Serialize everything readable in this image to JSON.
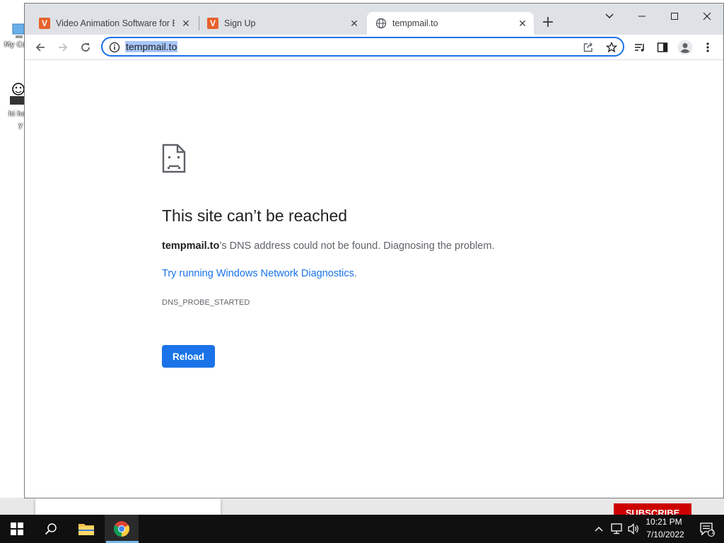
{
  "desktop": {
    "icon1_label": "My Co",
    "icon2_label": "hi he",
    "icon2_sub": "y",
    "subscribe_label": "SUBSCRIBE"
  },
  "browser": {
    "tabs": [
      {
        "title": "Video Animation Software for Bu",
        "favicon": "V",
        "active": false
      },
      {
        "title": "Sign Up",
        "favicon": "V",
        "active": false
      },
      {
        "title": "tempmail.to",
        "favicon": "globe-icon",
        "active": true
      }
    ],
    "address": {
      "url": "tempmail.to"
    }
  },
  "error_page": {
    "title": "This site can’t be reached",
    "host": "tempmail.to",
    "description_rest": "’s DNS address could not be found. Diagnosing the problem.",
    "link_text": "Try running Windows Network Diagnostics",
    "link_period": ".",
    "error_code": "DNS_PROBE_STARTED",
    "reload_label": "Reload"
  },
  "taskbar": {
    "time": "10:21 PM",
    "date": "7/10/2022",
    "notification_count": "1"
  },
  "colors": {
    "accent": "#1a73e8",
    "tabstrip": "#dee1e6",
    "taskbar": "#101010"
  }
}
